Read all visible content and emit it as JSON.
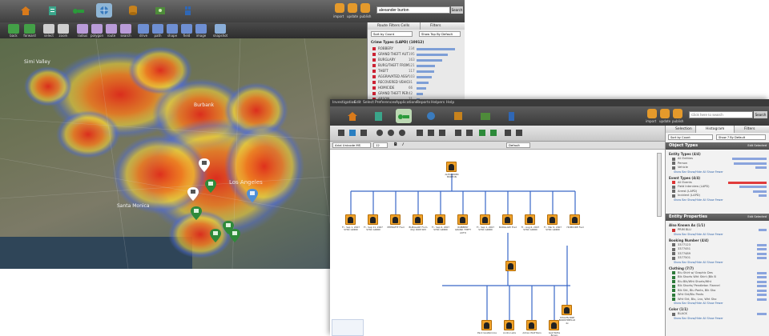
{
  "left_app": {
    "search_value": "alexander burton",
    "search_button": "Search",
    "top_right_buttons": [
      "import",
      "update",
      "publish"
    ],
    "toolbar_buttons": [
      "back",
      "forward",
      "select",
      "zoom",
      "radius",
      "polygon",
      "route",
      "search",
      "drive",
      "path",
      "shape",
      "field",
      "image",
      "snapshot"
    ],
    "map_labels": [
      "Simi Valley",
      "Burbank",
      "Los Angeles",
      "Santa Monica"
    ],
    "panel_tabs": [
      "Route Filters Cells",
      "Filters"
    ],
    "panel_sort": "Sort by Count",
    "panel_show": "Show Top By Default",
    "crime_group_title": "Crime Types (LAPD) (10012)",
    "crime_types": [
      {
        "label": "ROBBERY",
        "count": "234",
        "level": 0.95
      },
      {
        "label": "GRAND THEFT AUTO",
        "count": "195",
        "level": 0.78
      },
      {
        "label": "BURGLARY",
        "count": "163",
        "level": 0.63
      },
      {
        "label": "BURG/THEFT FROM V",
        "count": "121",
        "level": 0.46
      },
      {
        "label": "THEFT",
        "count": "117",
        "level": 0.44
      },
      {
        "label": "AGGRAVATED ASSAU",
        "count": "103",
        "level": 0.38
      },
      {
        "label": "RECOVERED VEHICLE",
        "count": "81",
        "level": 0.3
      },
      {
        "label": "HOMICIDE",
        "count": "66",
        "level": 0.24
      },
      {
        "label": "GRAND THEFT PERSO",
        "count": "42",
        "level": 0.15
      },
      {
        "label": "ARSON",
        "count": "21",
        "level": 0.08
      },
      {
        "label": "HOMICIDE",
        "count": "5",
        "level": 0.03
      }
    ]
  },
  "right_app": {
    "menu": [
      "Investigation",
      "Edit",
      "Select",
      "Preferences",
      "Applications",
      "Reports",
      "Helpers",
      "Help"
    ],
    "search_placeholder": "Click here to search",
    "search_button": "Search",
    "top_right_buttons": [
      "import",
      "update",
      "publish"
    ],
    "font_name": "Arial Unicode MS",
    "font_size": "12",
    "align_value": "Default",
    "panel_tabs": [
      "Selection",
      "Histogram",
      "Filters"
    ],
    "panel_sort": "Sort by Count",
    "panel_show": "Show 7 By Default",
    "object_types_header": "Object Types",
    "object_types_link": "Edit Selected",
    "entity_properties_header": "Entity Properties",
    "entity_properties_link": "Edit Selected",
    "object_groups": [
      {
        "title": "Entity Types (4/4)",
        "rows": [
          {
            "label": "All Entities",
            "level": 0.9,
            "color": "#6b6b6b"
          },
          {
            "label": "Person",
            "level": 0.85,
            "color": "#6b6b6b"
          },
          {
            "label": "Vehicle",
            "level": 0.3,
            "color": "#6b6b6b"
          }
        ]
      },
      {
        "title": "Event Types (4/4)",
        "rows": [
          {
            "label": "All Events",
            "level": 1.0,
            "color": "#d33"
          },
          {
            "label": "Field Interview (LAPD)",
            "level": 0.7,
            "color": "#6b6b6b"
          },
          {
            "label": "Arrest (LAPD)",
            "level": 0.35,
            "color": "#6b6b6b"
          },
          {
            "label": "Incident (LAPD)",
            "level": 0.2,
            "color": "#6b6b6b"
          }
        ]
      }
    ],
    "entity_groups": [
      {
        "title": "Also Known As (1/1)",
        "rows": [
          {
            "label": "PRIM BLU",
            "level": 0.2,
            "color": "#c33"
          }
        ]
      },
      {
        "title": "Booking Number (4/4)",
        "rows": [
          {
            "label": "3377123",
            "level": 0.25,
            "color": "#6b6b6b"
          },
          {
            "label": "3377451",
            "level": 0.25,
            "color": "#6b6b6b"
          },
          {
            "label": "3377489",
            "level": 0.25,
            "color": "#6b6b6b"
          },
          {
            "label": "3377501",
            "level": 0.25,
            "color": "#6b6b6b"
          }
        ]
      },
      {
        "title": "Clothing (7/7)",
        "rows": [
          {
            "label": "Blu Shirt w/ Graphic Des",
            "level": 0.25,
            "color": "#2d7a3b"
          },
          {
            "label": "Blk Shorts Wht Shirt (Blk B",
            "level": 0.25,
            "color": "#2d7a3b"
          },
          {
            "label": "Blu Blk/Wht Shorts/Wht",
            "level": 0.25,
            "color": "#2d7a3b"
          },
          {
            "label": "Blk Shorts/ Pendleton Flannel",
            "level": 0.25,
            "color": "#2d7a3b"
          },
          {
            "label": "Blk Sht, Blu Pants, Blk Sho",
            "level": 0.25,
            "color": "#2d7a3b"
          },
          {
            "label": "Wht Sht/Blu Pants",
            "level": 0.25,
            "color": "#2d7a3b"
          },
          {
            "label": "Wht Sht, Blu, Lnx, Wht Sho",
            "level": 0.25,
            "color": "#2d7a3b"
          }
        ]
      },
      {
        "title": "Color (1/1)",
        "rows": [
          {
            "label": "BLACK",
            "level": 0.25,
            "color": "#6b6b6b"
          }
        ]
      }
    ],
    "group_links": [
      "Show Bar",
      "Show/Hide All",
      "Show Fewer"
    ],
    "graph_nodes": {
      "root": "ALEXANDER BURTON",
      "row1": [
        "FI - Sep 1, 2007 SYNC GRIND",
        "FI - Sep 11, 2007 SYNC GRIND",
        "PHERLETT Fred",
        "BURGLARY From (N.J) ROM SIM",
        "FI - Sep 6, 2007 SYNC GRIND",
        "ROBBERY GRAND THEFT AUTO",
        "FI - Sep 1, 2007 SYNC GRIND",
        "BURGLARY Fred",
        "FI - Aug 6, 2007 SYNC GRIND",
        "FI - Mar 6, 2007 SYNC GRIND",
        "HOMICIDE Fred"
      ],
      "mid": "STOLEN BIKE BIANCHIBELLO 4x",
      "bottom": [
        "Pack Goatskinnie",
        "Andre Lada",
        "Adrian Wolf Ners",
        "Gail Motte Brown"
      ]
    }
  }
}
